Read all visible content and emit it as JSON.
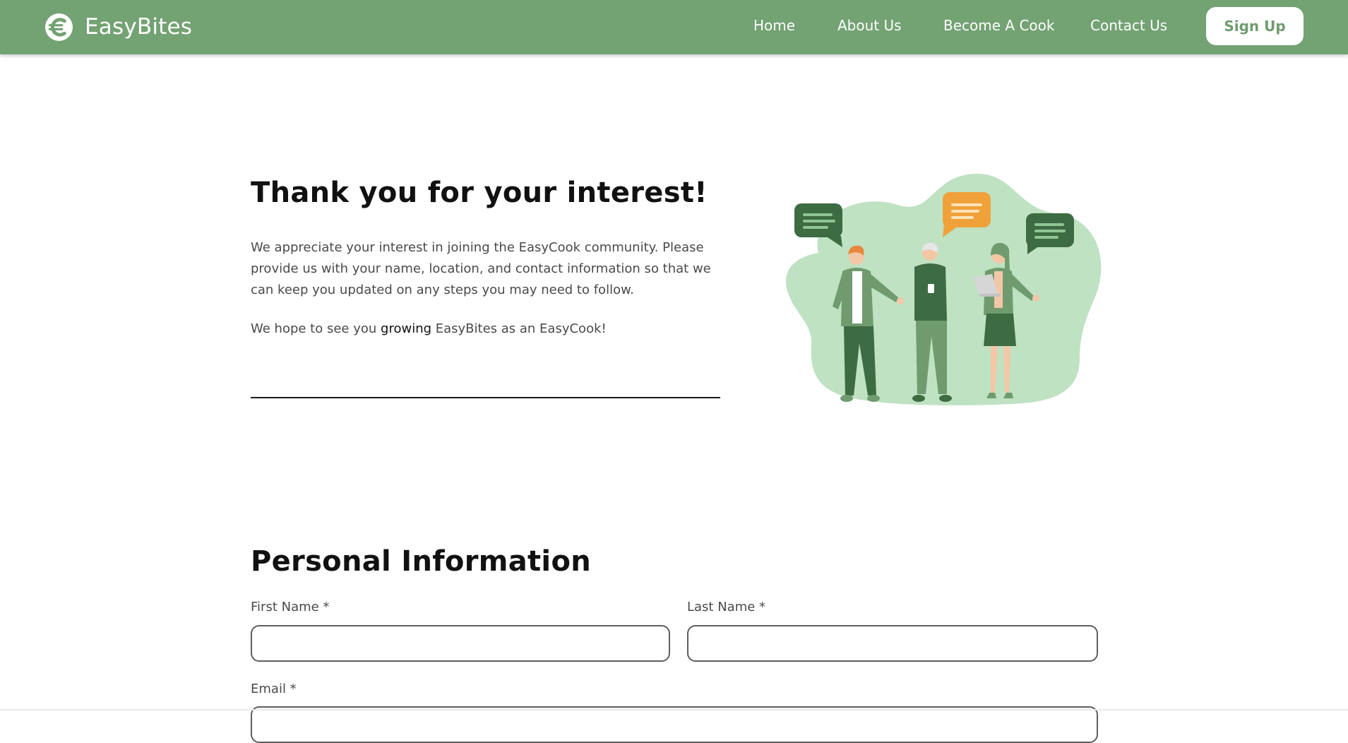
{
  "header": {
    "brand_name": "EasyBites",
    "nav": [
      {
        "label": "Home"
      },
      {
        "label": "About Us"
      },
      {
        "label": "Become A Cook"
      },
      {
        "label": "Contact Us"
      }
    ],
    "signup_label": "Sign Up"
  },
  "intro": {
    "title": "Thank you for your interest!",
    "paragraph1": "We appreciate your interest in joining the EasyCook community. Please provide us with your name, location, and contact information so that we can keep you updated on any steps you may need to follow.",
    "paragraph2_before": "We hope to see you ",
    "paragraph2_strong": "growing",
    "paragraph2_after": " EasyBites as an EasyCook!"
  },
  "form": {
    "section_title": "Personal Information",
    "first_name_label": "First Name *",
    "first_name_value": "",
    "last_name_label": "Last Name *",
    "last_name_value": "",
    "email_label": "Email *",
    "email_value": ""
  },
  "colors": {
    "header_bg": "#73a273",
    "accent_green": "#6f9b6f",
    "blob_green": "#bfe2c2",
    "dark_green": "#3d6b42",
    "bubble_orange": "#f0a13a"
  },
  "icons": {
    "logo": "easybites-logo-icon",
    "illustration": "people-chatting-illustration"
  }
}
